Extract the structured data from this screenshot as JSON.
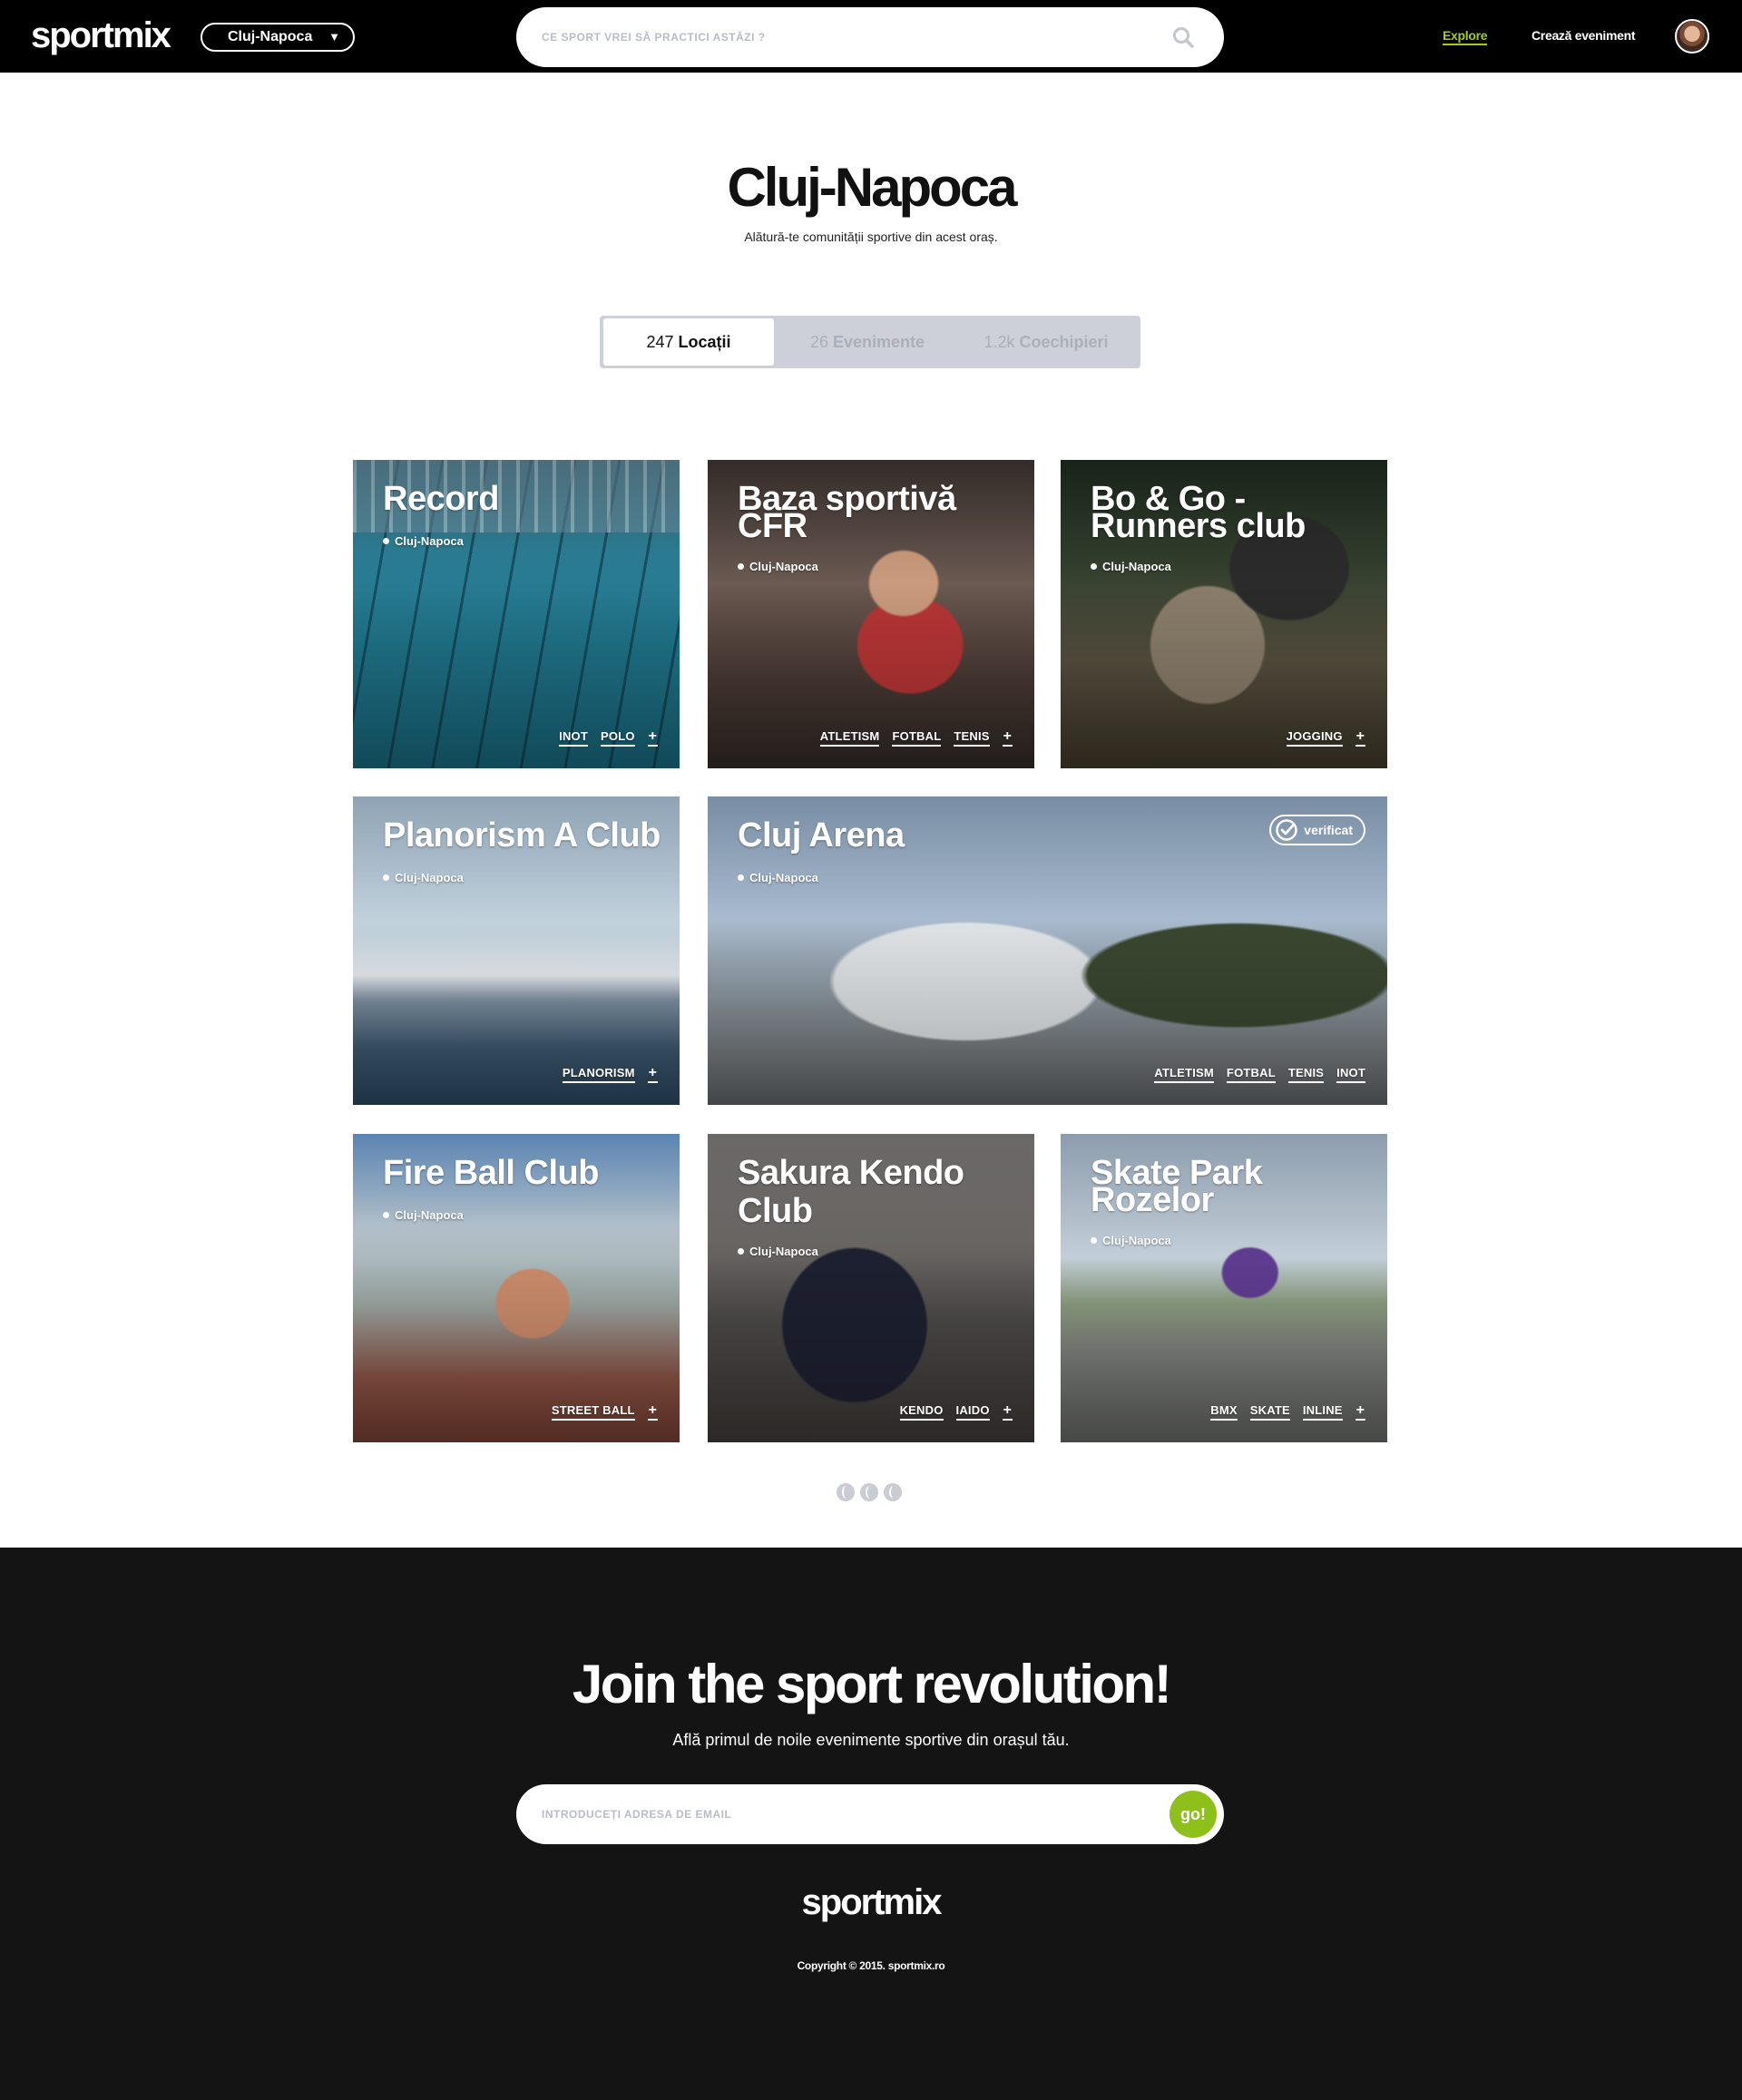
{
  "header": {
    "logo": "sportmix",
    "city": "Cluj-Napoca",
    "search_placeholder": "CE SPORT VREI SĂ PRACTICI ASTĂZI ?",
    "nav": {
      "explore": "Explore",
      "create_event": "Crează eveniment"
    }
  },
  "hero": {
    "title": "Cluj-Napoca",
    "subtitle": "Alătură-te comunității sportive din acest oraș."
  },
  "tabs": [
    {
      "count": "247",
      "label": "Locații",
      "active": true
    },
    {
      "count": "26",
      "label": "Evenimente",
      "active": false
    },
    {
      "count": "1.2k",
      "label": "Coechipieri",
      "active": false
    }
  ],
  "cards": [
    {
      "title": "Record",
      "location": "Cluj-Napoca",
      "tags": [
        "INOT",
        "POLO"
      ],
      "more": "+"
    },
    {
      "title": "Baza sportivă CFR",
      "location": "Cluj-Napoca",
      "tags": [
        "ATLETISM",
        "FOTBAL",
        "TENIS"
      ],
      "more": "+"
    },
    {
      "title": "Bo & Go - Runners club",
      "location": "Cluj-Napoca",
      "tags": [
        "JOGGING"
      ],
      "more": "+"
    },
    {
      "title": "Planorism A Club",
      "location": "Cluj-Napoca",
      "tags": [
        "PLANORISM"
      ],
      "more": "+"
    },
    {
      "title": "Cluj Arena",
      "location": "Cluj-Napoca",
      "tags": [
        "ATLETISM",
        "FOTBAL",
        "TENIS",
        "INOT"
      ],
      "badge": "verificat"
    },
    {
      "title": "Fire Ball Club",
      "location": "Cluj-Napoca",
      "tags": [
        "STREET BALL"
      ],
      "more": "+"
    },
    {
      "title": "Sakura Kendo Club",
      "location": "Cluj-Napoca",
      "tags": [
        "KENDO",
        "IAIDO"
      ],
      "more": "+"
    },
    {
      "title": "Skate Park Rozelor",
      "location": "Cluj-Napoca",
      "tags": [
        "BMX",
        "SKATE",
        "INLINE"
      ],
      "more": "+"
    }
  ],
  "footer": {
    "title": "Join the sport revolution!",
    "subtitle": "Află primul de noile evenimente sportive din orașul tău.",
    "email_placeholder": "INTRODUCEȚI ADRESA DE EMAIL",
    "go_label": "go!",
    "logo": "sportmix",
    "copyright": "Copyright © 2015. sportmix.ro"
  },
  "colors": {
    "accent": "#8dc01a",
    "nav_active": "#a4cd18",
    "header_bg": "#000000",
    "footer_bg": "#141414"
  }
}
